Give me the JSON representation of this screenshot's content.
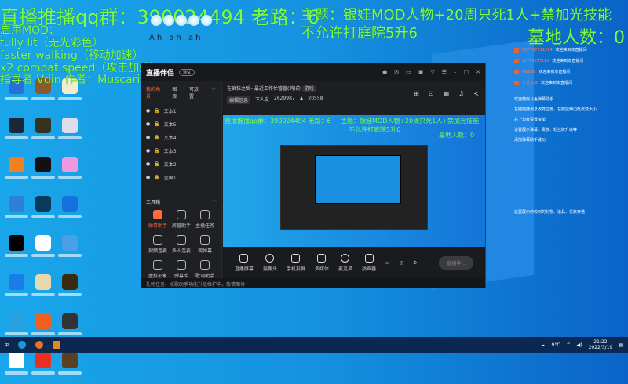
{
  "overlay": {
    "qq_line": "直播推播qq群：390024494 老路：6",
    "theme": "主题：银娃MOD人物+20周只死1人+禁加光技能",
    "rule": "不允许打庭院5升6",
    "graveyard": "墓地人数：0",
    "mods_title": "启用MOD：",
    "mods": [
      "fully lit（无光彩色）",
      "faster walking（移动加速）",
      "x2 combat speed（攻击加速）",
      "指导者 Vdin 作者：Muscarine"
    ],
    "ah": "Ah ah ah"
  },
  "app": {
    "name": "直播伴侣",
    "beta": "测试",
    "scene_tabs": [
      "我的场景",
      "图库",
      "可放置"
    ],
    "add": "+",
    "scenes": [
      "文本1",
      "文本5",
      "文本4",
      "文本3",
      "文本2",
      "全屏1"
    ],
    "stream_title": "在疯狂之后~最近工作忙管管(鸽)的",
    "tag": "游戏",
    "edit_label": "编辑信息",
    "followers_label": "下人友",
    "followers": "2629987",
    "hot": "20558",
    "toolbox_title": "工具箱",
    "tools": [
      "弹幕助手",
      "房管助手",
      "主播任务",
      "视频连麦",
      "多人连麦",
      "调弹幕",
      "虚拟形象",
      "弹幕库",
      "歌词助手"
    ],
    "controls": [
      "直播屏幕",
      "摄像头",
      "手机投屏",
      "多媒体",
      "麦克风",
      "扬声器"
    ],
    "start": "直播中...",
    "status": "礼物任务、点歌助手功能升级维护中，敬请期待"
  },
  "chat": {
    "joins": [
      {
        "user": "用户707311214",
        "msg": "欢迎来到本直播间"
      },
      {
        "user": "s1755677118",
        "msg": "欢迎来到本直播间"
      },
      {
        "user": "OG836",
        "msg": "欢迎来到本直播间"
      },
      {
        "user": "天论云体",
        "msg": "欢迎来到本直播间"
      }
    ],
    "help": [
      "欢迎使用斗鱼弹幕助手",
      "左键拖拽消息改变位置，左键拉伸边框改变大小",
      "右上角有设置菜单",
      "设置展示弹幕、贵族、粉丝牌升级等",
      "添加弹幕助手成功"
    ],
    "gift_note": "这里展示你收到的礼物、道具、贵族开通"
  },
  "taskbar": {
    "weather": "9°C",
    "time": "21:22",
    "date": "2022/3/19"
  }
}
